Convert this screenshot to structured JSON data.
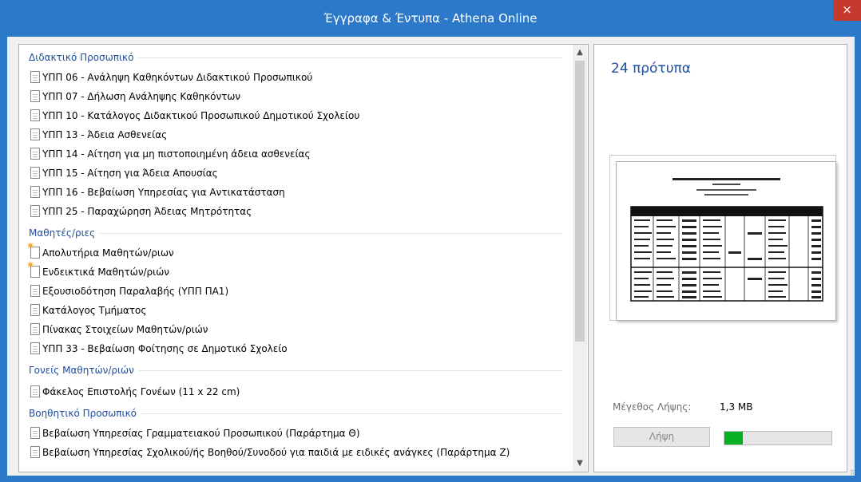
{
  "window": {
    "title": "Έγγραφα & Έντυπα - Athena Online",
    "close_glyph": "×"
  },
  "groups": [
    {
      "header": "Διδακτικό Προσωπικό",
      "items": [
        {
          "label": "ΥΠΠ 06 - Ανάληψη Καθηκόντων Διδακτικού Προσωπικού",
          "icon": "document-icon"
        },
        {
          "label": "ΥΠΠ 07 - Δήλωση Ανάληψης Καθηκόντων",
          "icon": "document-icon"
        },
        {
          "label": "ΥΠΠ 10 - Κατάλογος Διδακτικού Προσωπικού Δημοτικού Σχολείου",
          "icon": "document-icon"
        },
        {
          "label": "ΥΠΠ 13 - Άδεια Ασθενείας",
          "icon": "document-icon"
        },
        {
          "label": "ΥΠΠ 14 - Αίτηση για μη πιστοποιημένη άδεια ασθενείας",
          "icon": "document-icon"
        },
        {
          "label": "ΥΠΠ 15 - Αίτηση για Άδεια Απουσίας",
          "icon": "document-icon"
        },
        {
          "label": "ΥΠΠ 16 - Βεβαίωση Υπηρεσίας για Αντικατάσταση",
          "icon": "document-icon"
        },
        {
          "label": "ΥΠΠ 25 - Παραχώρηση Άδειας Μητρότητας",
          "icon": "document-icon"
        }
      ]
    },
    {
      "header": "Μαθητές/ριες",
      "items": [
        {
          "label": "Απολυτήρια Μαθητών/ριων",
          "icon": "new-document-icon"
        },
        {
          "label": "Ενδεικτικά Μαθητών/ριών",
          "icon": "new-document-icon"
        },
        {
          "label": "Εξουσιοδότηση Παραλαβής (ΥΠΠ ΠΑ1)",
          "icon": "document-icon"
        },
        {
          "label": "Κατάλογος Τμήματος",
          "icon": "document-icon"
        },
        {
          "label": "Πίνακας Στοιχείων Μαθητών/ριών",
          "icon": "document-icon"
        },
        {
          "label": "ΥΠΠ 33 - Βεβαίωση Φοίτησης σε Δημοτικό Σχολείο",
          "icon": "document-icon"
        }
      ]
    },
    {
      "header": "Γονείς Μαθητών/ριών",
      "items": [
        {
          "label": "Φάκελος Επιστολής Γονέων (11 x 22 cm)",
          "icon": "document-icon"
        }
      ]
    },
    {
      "header": "Βοηθητικό Προσωπικό",
      "items": [
        {
          "label": "Βεβαίωση Υπηρεσίας Γραμματειακού Προσωπικού (Παράρτημα Θ)",
          "icon": "document-icon"
        },
        {
          "label": "Βεβαίωση Υπηρεσίας Σχολικού/ής Βοηθού/Συνοδού για παιδιά με ειδικές ανάγκες (Παράρτημα Ζ)",
          "icon": "document-icon"
        }
      ]
    }
  ],
  "preview": {
    "count_label": "24 πρότυπα",
    "size_label": "Μέγεθος Λήψης:",
    "size_value": "1,3 MB",
    "download_label": "Λήψη",
    "progress_fraction": 0.17
  },
  "colors": {
    "accent": "#2b79c8",
    "header_text": "#1e4e9e",
    "close": "#c7392c",
    "progress": "#06b025"
  }
}
